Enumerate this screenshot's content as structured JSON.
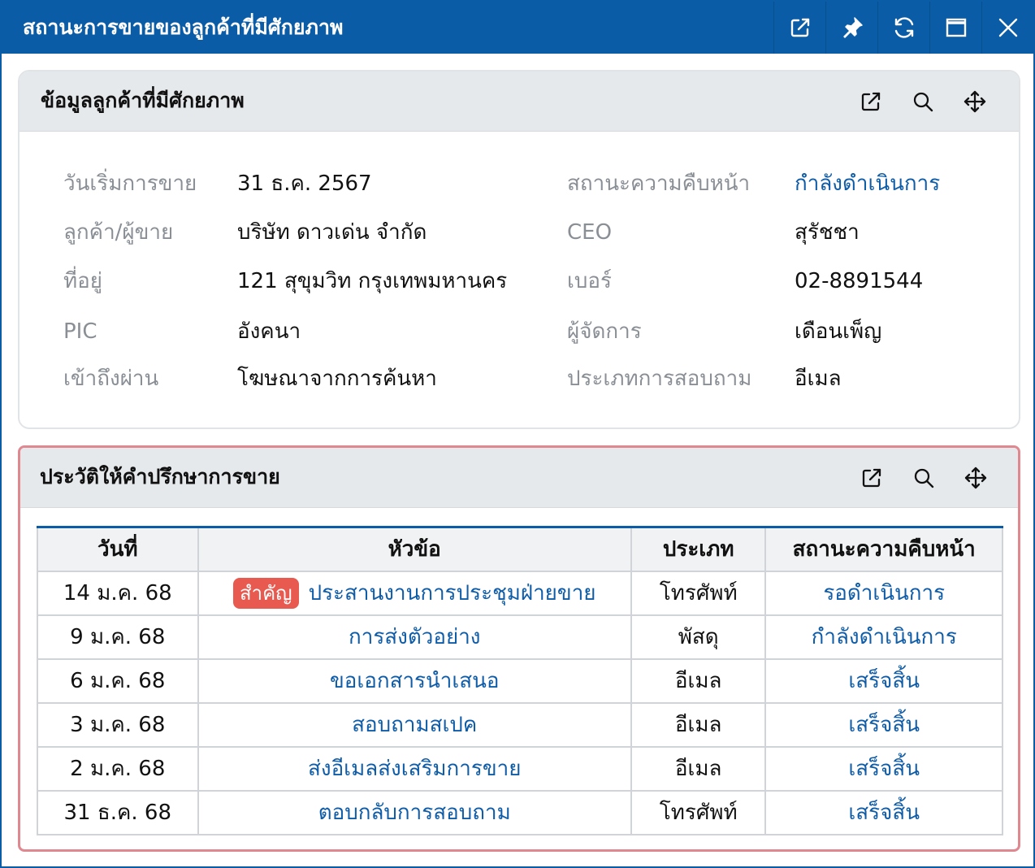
{
  "window": {
    "title": "สถานะการขายของลูกค้าที่มีศักยภาพ",
    "buttons": [
      "external-link-icon",
      "pin-icon",
      "refresh-icon",
      "maximize-icon",
      "close-icon"
    ]
  },
  "info_panel": {
    "title": "ข้อมูลลูกค้าที่มีศักยภาพ",
    "rows": [
      {
        "label1": "วันเริ่มการขาย",
        "value1": "31 ธ.ค. 2567",
        "label2": "สถานะความคืบหน้า",
        "value2": "กำลังดำเนินการ"
      },
      {
        "label1": "ลูกค้า/ผู้ขาย",
        "value1": "บริษัท ดาวเด่น จำกัด",
        "label2": "CEO",
        "value2": "สุรัชชา"
      },
      {
        "label1": "ที่อยู่",
        "value1": "121 สุขุมวิท กรุงเทพมหานคร",
        "label2": "เบอร์",
        "value2": "02-8891544"
      },
      {
        "label1": "PIC",
        "value1": "อังคนา",
        "label2": "ผู้จัดการ",
        "value2": "เดือนเพ็ญ"
      },
      {
        "label1": "เข้าถึงผ่าน",
        "value1": "โฆษณาจากการค้นหา",
        "label2": "ประเภทการสอบถาม",
        "value2": "อีเมล"
      }
    ]
  },
  "history_panel": {
    "title": "ประวัติให้คำปรึกษาการขาย",
    "columns": [
      "วันที่",
      "หัวข้อ",
      "ประเภท",
      "สถานะความคืบหน้า"
    ],
    "rows": [
      {
        "date": "14 ม.ค. 68",
        "badge": "สำคัญ",
        "topic": "ประสานงานการประชุมฝ่ายขาย",
        "type": "โทรศัพท์",
        "status": "รอดำเนินการ"
      },
      {
        "date": "9 ม.ค. 68",
        "badge": "",
        "topic": "การส่งตัวอย่าง",
        "type": "พัสดุ",
        "status": "กำลังดำเนินการ"
      },
      {
        "date": "6 ม.ค. 68",
        "badge": "",
        "topic": "ขอเอกสารนำเสนอ",
        "type": "อีเมล",
        "status": "เสร็จสิ้น"
      },
      {
        "date": "3 ม.ค. 68",
        "badge": "",
        "topic": "สอบถามสเปค",
        "type": "อีเมล",
        "status": "เสร็จสิ้น"
      },
      {
        "date": "2 ม.ค. 68",
        "badge": "",
        "topic": "ส่งอีเมลส่งเสริมการขาย",
        "type": "อีเมล",
        "status": "เสร็จสิ้น"
      },
      {
        "date": "31 ธ.ค. 68",
        "badge": "",
        "topic": "ตอบกลับการสอบถาม",
        "type": "โทรศัพท์",
        "status": "เสร็จสิ้น"
      }
    ]
  },
  "panel_icons": [
    "external-link-icon",
    "search-icon",
    "move-icon"
  ],
  "colors": {
    "titlebar": "#0a5ca6",
    "link": "#0f5ca8",
    "badge": "#e8594f",
    "label": "#8a8f96",
    "selected_border": "#e08890"
  }
}
